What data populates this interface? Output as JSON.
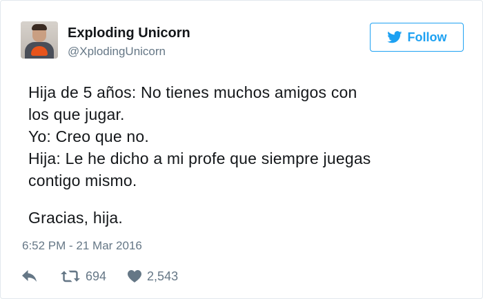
{
  "user": {
    "display_name": "Exploding Unicorn",
    "handle": "@XplodingUnicorn",
    "avatar_icon": "profile-photo"
  },
  "follow": {
    "label": "Follow",
    "icon": "twitter-bird-icon",
    "color": "#1da1f2"
  },
  "tweet": {
    "lines": [
      "Hija de 5 años: No tienes muchos amigos con",
      "los que jugar.",
      "Yo: Creo que no.",
      "Hija: Le he dicho a mi profe que siempre juegas",
      "contigo mismo.",
      "",
      "Gracias, hija."
    ],
    "timestamp": "6:52 PM - 21 Mar 2016"
  },
  "actions": {
    "reply_icon": "reply-icon",
    "retweet_icon": "retweet-icon",
    "retweet_count": "694",
    "like_icon": "heart-icon",
    "like_count": "2,543"
  }
}
